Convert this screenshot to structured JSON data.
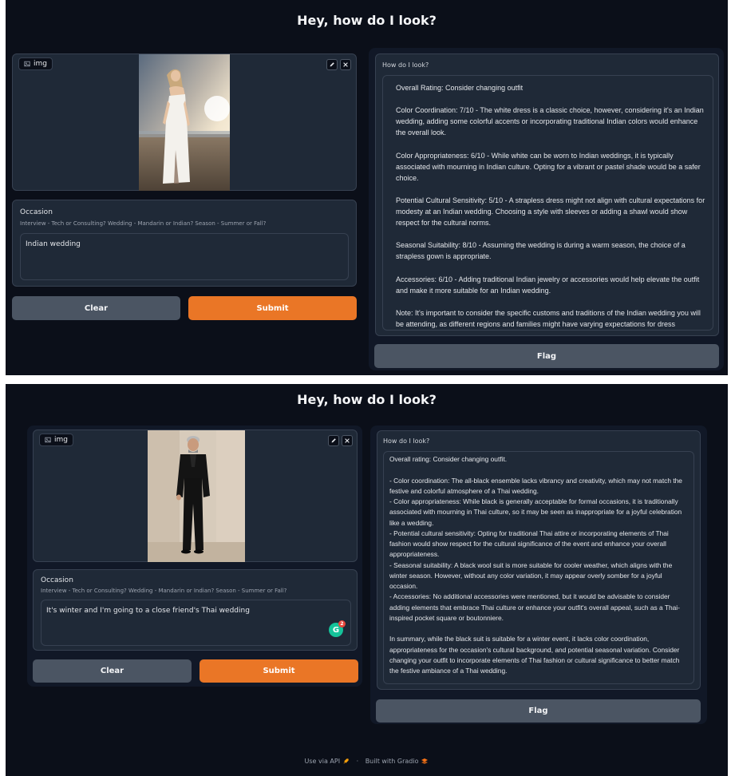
{
  "app_title": "Hey, how do I look?",
  "image_component": {
    "label": "img"
  },
  "icons": {
    "edit": "pencil-icon",
    "close": "close-icon",
    "image": "image-icon",
    "api": "rocket-icon",
    "gradio": "gradio-logo-icon",
    "grammarly": "grammarly-icon"
  },
  "occasion": {
    "label": "Occasion",
    "info": "Interview - Tech or Consulting? Wedding - Mandarin or Indian? Season - Summer or Fall?"
  },
  "buttons": {
    "clear": "Clear",
    "submit": "Submit",
    "flag": "Flag"
  },
  "output_label": "How do I look?",
  "sessions": [
    {
      "occasion_value": "Indian wedding",
      "output_paragraphs": [
        "Overall Rating: Consider changing outfit",
        "Color Coordination: 7/10 - The white dress is a classic choice, however, considering it's an Indian wedding, adding some colorful accents or incorporating traditional Indian colors would enhance the overall look.",
        "Color Appropriateness: 6/10 - While white can be worn to Indian weddings, it is typically associated with mourning in Indian culture. Opting for a vibrant or pastel shade would be a safer choice.",
        "Potential Cultural Sensitivity: 5/10 - A strapless dress might not align with cultural expectations for modesty at an Indian wedding. Choosing a style with sleeves or adding a shawl would show respect for the cultural norms.",
        "Seasonal Suitability: 8/10 - Assuming the wedding is during a warm season, the choice of a strapless gown is appropriate.",
        "Accessories: 6/10 - Adding traditional Indian jewelry or accessories would help elevate the outfit and make it more suitable for an Indian wedding.",
        "Note: It's important to consider the specific customs and traditions of the Indian wedding you will be attending, as different regions and families might have varying expectations for dress"
      ]
    },
    {
      "occasion_value": "It's winter and I'm going to a close friend's Thai wedding",
      "grammarly_badge": "2",
      "output_paragraphs": [
        "Overall rating: Consider changing outfit.",
        "- Color coordination: The all-black ensemble lacks vibrancy and creativity, which may not match the festive and colorful atmosphere of a Thai wedding.\n- Color appropriateness: While black is generally acceptable for formal occasions, it is traditionally associated with mourning in Thai culture, so it may be seen as inappropriate for a joyful celebration like a wedding.\n- Potential cultural sensitivity: Opting for traditional Thai attire or incorporating elements of Thai fashion would show respect for the cultural significance of the event and enhance your overall appropriateness.\n- Seasonal suitability: A black wool suit is more suitable for cooler weather, which aligns with the winter season. However, without any color variation, it may appear overly somber for a joyful occasion.\n- Accessories: No additional accessories were mentioned, but it would be advisable to consider adding elements that embrace Thai culture or enhance your outfit's overall appeal, such as a Thai-inspired pocket square or boutonniere.",
        "In summary, while the black suit is suitable for a winter event, it lacks color coordination, appropriateness for the occasion's cultural background, and potential seasonal variation. Consider changing your outfit to incorporate elements of Thai fashion or cultural significance to better match the festive ambiance of a Thai wedding."
      ]
    }
  ],
  "footer": {
    "api": "Use via API",
    "separator": "·",
    "built_with": "Built with Gradio"
  }
}
